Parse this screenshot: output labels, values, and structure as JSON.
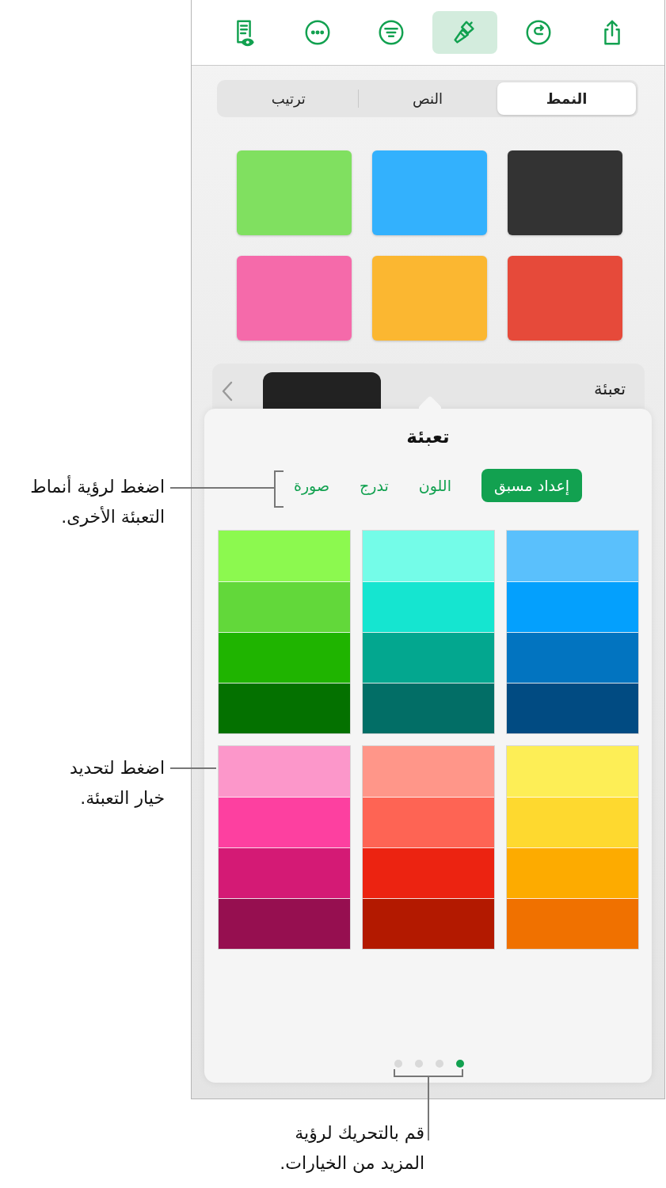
{
  "toolbar": {
    "buttons": [
      {
        "selected": false
      },
      {
        "selected": false
      },
      {
        "selected": false
      },
      {
        "selected": true
      },
      {
        "selected": false
      },
      {
        "selected": false
      }
    ]
  },
  "tabs": [
    {
      "label": "النمط",
      "selected": true
    },
    {
      "label": "النص",
      "selected": false
    },
    {
      "label": "ترتيب",
      "selected": false
    }
  ],
  "style_swatches": [
    {
      "color": "#333333"
    },
    {
      "color": "#33b1fd"
    },
    {
      "color": "#80e060"
    },
    {
      "color": "#e64a3a"
    },
    {
      "color": "#fbb731"
    },
    {
      "color": "#f56aaa"
    }
  ],
  "fill_row": {
    "label": "تعبئة",
    "color": "#222222"
  },
  "fill_popover": {
    "title": "تعبئة",
    "tabs": [
      {
        "label": "إعداد مسبق",
        "selected": true
      },
      {
        "label": "اللون",
        "selected": false
      },
      {
        "label": "تدرج",
        "selected": false
      },
      {
        "label": "صورة",
        "selected": false
      }
    ],
    "presets": [
      {
        "swatches": [
          {
            "color": "#5ac0fc"
          },
          {
            "color": "#04a0fd"
          },
          {
            "color": "#0274c0"
          },
          {
            "color": "#014b82"
          }
        ]
      },
      {
        "swatches": [
          {
            "color": "#74fce8"
          },
          {
            "color": "#15e5d0"
          },
          {
            "color": "#03a78f"
          },
          {
            "color": "#026e66"
          }
        ]
      },
      {
        "swatches": [
          {
            "color": "#8cf94f"
          },
          {
            "color": "#62d83a"
          },
          {
            "color": "#1fb400"
          },
          {
            "color": "#047100"
          }
        ]
      },
      {
        "swatches": [
          {
            "color": "#fdee56"
          },
          {
            "color": "#fed92f"
          },
          {
            "color": "#fdab00"
          },
          {
            "color": "#f07100"
          }
        ]
      },
      {
        "swatches": [
          {
            "color": "#ff9689"
          },
          {
            "color": "#fe6454"
          },
          {
            "color": "#ec2311"
          },
          {
            "color": "#b31900"
          }
        ]
      },
      {
        "swatches": [
          {
            "color": "#fc97ca"
          },
          {
            "color": "#fd40a0"
          },
          {
            "color": "#d41a75"
          },
          {
            "color": "#960f50"
          }
        ]
      }
    ],
    "pages": [
      {
        "selected": true
      },
      {
        "selected": false
      },
      {
        "selected": false
      },
      {
        "selected": false
      }
    ]
  },
  "callouts": [
    {
      "text": "اضغط لرؤية أنماط التعبئة الأخرى."
    },
    {
      "text": "اضغط لتحديد خيار التعبئة."
    },
    {
      "text": "قم بالتحريك لرؤية المزيد من الخيارات."
    }
  ]
}
